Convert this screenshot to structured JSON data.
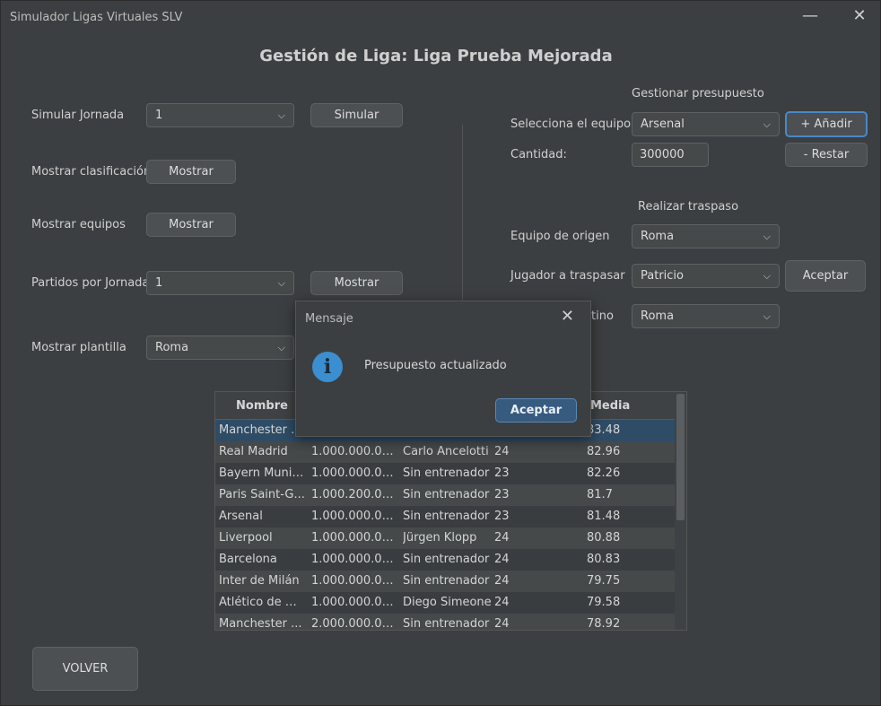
{
  "window": {
    "title": "Simulador Ligas Virtuales SLV"
  },
  "heading": "Gestión de Liga: Liga Prueba Mejorada",
  "left": {
    "simular_jornada": {
      "label": "Simular Jornada",
      "value": "1",
      "button": "Simular"
    },
    "mostrar_clasificacion": {
      "label": "Mostrar clasificación",
      "button": "Mostrar"
    },
    "mostrar_equipos": {
      "label": "Mostrar equipos",
      "button": "Mostrar"
    },
    "partidos_jornada": {
      "label": "Partidos por Jornada",
      "value": "1",
      "button": "Mostrar"
    },
    "mostrar_plantilla": {
      "label": "Mostrar plantilla",
      "value": "Roma"
    }
  },
  "presupuesto": {
    "title": "Gestionar presupuesto",
    "equipo_label": "Selecciona el equipo",
    "equipo_value": "Arsenal",
    "add_button": "+ Añadir",
    "cantidad_label": "Cantidad:",
    "cantidad_value": "300000",
    "restar_button": "- Restar"
  },
  "traspaso": {
    "title": "Realizar traspaso",
    "origen_label": "Equipo de origen",
    "origen_value": "Roma",
    "jugador_label": "Jugador a traspasar",
    "jugador_value": "Patricio",
    "aceptar_button": "Aceptar",
    "destino_label_visible": "tino",
    "destino_value": "Roma"
  },
  "table": {
    "headers": [
      "Nombre",
      "",
      "",
      "",
      "Media equi..."
    ],
    "rows": [
      [
        "Manchester C...",
        "",
        "",
        "",
        "83.48"
      ],
      [
        "Real Madrid",
        "1.000.000.00...",
        "Carlo Ancelotti",
        "24",
        "82.96"
      ],
      [
        "Bayern Munich",
        "1.000.000.00...",
        "Sin entrenador",
        "23",
        "82.26"
      ],
      [
        "Paris Saint-G...",
        "1.000.200.00...",
        "Sin entrenador",
        "23",
        "81.7"
      ],
      [
        "Arsenal",
        "1.000.000.00...",
        "Sin entrenador",
        "23",
        "81.48"
      ],
      [
        "Liverpool",
        "1.000.000.00...",
        "Jürgen Klopp",
        "24",
        "80.88"
      ],
      [
        "Barcelona",
        "1.000.000.00...",
        "Sin entrenador",
        "24",
        "80.83"
      ],
      [
        "Inter de Milán",
        "1.000.000.00...",
        "Sin entrenador",
        "24",
        "79.75"
      ],
      [
        "Atlético de M...",
        "1.000.000.00...",
        "Diego Simeone",
        "24",
        "79.58"
      ],
      [
        "Manchester ...",
        "2.000.000.00...",
        "Sin entrenador",
        "24",
        "78.92"
      ]
    ]
  },
  "volver_button": "VOLVER",
  "dialog": {
    "title": "Mensaje",
    "message": "Presupuesto actualizado",
    "button": "Aceptar",
    "icon_glyph": "i"
  }
}
